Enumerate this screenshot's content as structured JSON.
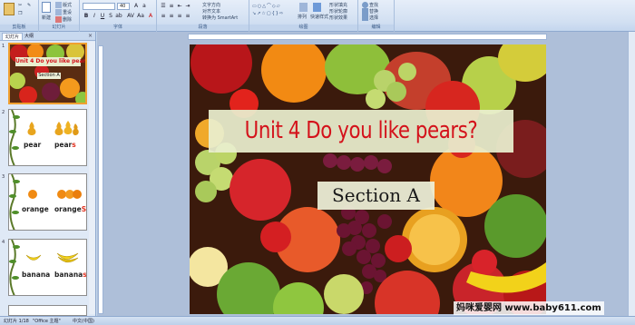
{
  "ribbon": {
    "groups": [
      {
        "label": "剪贴板"
      },
      {
        "label": "幻灯片"
      },
      {
        "label": "字体"
      },
      {
        "label": "段落"
      },
      {
        "label": "绘图"
      },
      {
        "label": "编辑"
      }
    ],
    "buttons": {
      "new_slide": "新建",
      "layout": "版式",
      "reset": "重设",
      "delete": "删除",
      "text_direction": "文字方向",
      "align_text": "对齐文本",
      "convert_smartart": "转换为 SmartArt",
      "arrange": "排列",
      "quick_styles": "快速样式",
      "shape_fill": "形状填充",
      "shape_outline": "形状轮廓",
      "shape_effects": "形状效果",
      "find": "查找",
      "replace": "替换",
      "select": "选择"
    },
    "font_size": "40"
  },
  "left_pane": {
    "tabs": [
      "幻灯片",
      "大纲"
    ],
    "slides": [
      {
        "num": "1",
        "title": "Unit 4 Do you like pears?",
        "subtitle": "Section A"
      },
      {
        "num": "2",
        "words": [
          {
            "base": "pear",
            "plural_base": "pear",
            "plural_suffix": "s"
          }
        ]
      },
      {
        "num": "3",
        "words": [
          {
            "base": "orange",
            "plural_base": "orange",
            "plural_suffix": "S"
          }
        ]
      },
      {
        "num": "4",
        "words": [
          {
            "base": "banana",
            "plural_base": "banana",
            "plural_suffix": "s"
          }
        ]
      }
    ]
  },
  "slide": {
    "title": "Unit 4 Do you like pears?",
    "subtitle": "Section A"
  },
  "status": {
    "slide_info": "幻灯片 1/18",
    "theme": "\"Office 主题\"",
    "language": "中文(中国)"
  },
  "watermark": "妈咪爱婴网 www.baby611.com",
  "colors": {
    "title_red": "#d4121b",
    "selected_border": "#f0a030",
    "ribbon_blue": "#d2e0f2"
  }
}
